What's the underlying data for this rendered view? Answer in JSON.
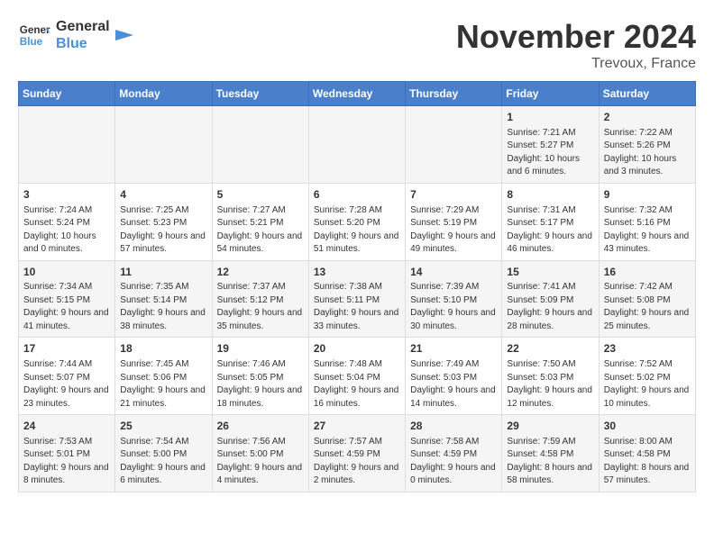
{
  "header": {
    "logo_line1": "General",
    "logo_line2": "Blue",
    "month": "November 2024",
    "location": "Trevoux, France"
  },
  "days_of_week": [
    "Sunday",
    "Monday",
    "Tuesday",
    "Wednesday",
    "Thursday",
    "Friday",
    "Saturday"
  ],
  "weeks": [
    [
      {
        "day": "",
        "info": ""
      },
      {
        "day": "",
        "info": ""
      },
      {
        "day": "",
        "info": ""
      },
      {
        "day": "",
        "info": ""
      },
      {
        "day": "",
        "info": ""
      },
      {
        "day": "1",
        "info": "Sunrise: 7:21 AM\nSunset: 5:27 PM\nDaylight: 10 hours and 6 minutes."
      },
      {
        "day": "2",
        "info": "Sunrise: 7:22 AM\nSunset: 5:26 PM\nDaylight: 10 hours and 3 minutes."
      }
    ],
    [
      {
        "day": "3",
        "info": "Sunrise: 7:24 AM\nSunset: 5:24 PM\nDaylight: 10 hours and 0 minutes."
      },
      {
        "day": "4",
        "info": "Sunrise: 7:25 AM\nSunset: 5:23 PM\nDaylight: 9 hours and 57 minutes."
      },
      {
        "day": "5",
        "info": "Sunrise: 7:27 AM\nSunset: 5:21 PM\nDaylight: 9 hours and 54 minutes."
      },
      {
        "day": "6",
        "info": "Sunrise: 7:28 AM\nSunset: 5:20 PM\nDaylight: 9 hours and 51 minutes."
      },
      {
        "day": "7",
        "info": "Sunrise: 7:29 AM\nSunset: 5:19 PM\nDaylight: 9 hours and 49 minutes."
      },
      {
        "day": "8",
        "info": "Sunrise: 7:31 AM\nSunset: 5:17 PM\nDaylight: 9 hours and 46 minutes."
      },
      {
        "day": "9",
        "info": "Sunrise: 7:32 AM\nSunset: 5:16 PM\nDaylight: 9 hours and 43 minutes."
      }
    ],
    [
      {
        "day": "10",
        "info": "Sunrise: 7:34 AM\nSunset: 5:15 PM\nDaylight: 9 hours and 41 minutes."
      },
      {
        "day": "11",
        "info": "Sunrise: 7:35 AM\nSunset: 5:14 PM\nDaylight: 9 hours and 38 minutes."
      },
      {
        "day": "12",
        "info": "Sunrise: 7:37 AM\nSunset: 5:12 PM\nDaylight: 9 hours and 35 minutes."
      },
      {
        "day": "13",
        "info": "Sunrise: 7:38 AM\nSunset: 5:11 PM\nDaylight: 9 hours and 33 minutes."
      },
      {
        "day": "14",
        "info": "Sunrise: 7:39 AM\nSunset: 5:10 PM\nDaylight: 9 hours and 30 minutes."
      },
      {
        "day": "15",
        "info": "Sunrise: 7:41 AM\nSunset: 5:09 PM\nDaylight: 9 hours and 28 minutes."
      },
      {
        "day": "16",
        "info": "Sunrise: 7:42 AM\nSunset: 5:08 PM\nDaylight: 9 hours and 25 minutes."
      }
    ],
    [
      {
        "day": "17",
        "info": "Sunrise: 7:44 AM\nSunset: 5:07 PM\nDaylight: 9 hours and 23 minutes."
      },
      {
        "day": "18",
        "info": "Sunrise: 7:45 AM\nSunset: 5:06 PM\nDaylight: 9 hours and 21 minutes."
      },
      {
        "day": "19",
        "info": "Sunrise: 7:46 AM\nSunset: 5:05 PM\nDaylight: 9 hours and 18 minutes."
      },
      {
        "day": "20",
        "info": "Sunrise: 7:48 AM\nSunset: 5:04 PM\nDaylight: 9 hours and 16 minutes."
      },
      {
        "day": "21",
        "info": "Sunrise: 7:49 AM\nSunset: 5:03 PM\nDaylight: 9 hours and 14 minutes."
      },
      {
        "day": "22",
        "info": "Sunrise: 7:50 AM\nSunset: 5:03 PM\nDaylight: 9 hours and 12 minutes."
      },
      {
        "day": "23",
        "info": "Sunrise: 7:52 AM\nSunset: 5:02 PM\nDaylight: 9 hours and 10 minutes."
      }
    ],
    [
      {
        "day": "24",
        "info": "Sunrise: 7:53 AM\nSunset: 5:01 PM\nDaylight: 9 hours and 8 minutes."
      },
      {
        "day": "25",
        "info": "Sunrise: 7:54 AM\nSunset: 5:00 PM\nDaylight: 9 hours and 6 minutes."
      },
      {
        "day": "26",
        "info": "Sunrise: 7:56 AM\nSunset: 5:00 PM\nDaylight: 9 hours and 4 minutes."
      },
      {
        "day": "27",
        "info": "Sunrise: 7:57 AM\nSunset: 4:59 PM\nDaylight: 9 hours and 2 minutes."
      },
      {
        "day": "28",
        "info": "Sunrise: 7:58 AM\nSunset: 4:59 PM\nDaylight: 9 hours and 0 minutes."
      },
      {
        "day": "29",
        "info": "Sunrise: 7:59 AM\nSunset: 4:58 PM\nDaylight: 8 hours and 58 minutes."
      },
      {
        "day": "30",
        "info": "Sunrise: 8:00 AM\nSunset: 4:58 PM\nDaylight: 8 hours and 57 minutes."
      }
    ]
  ]
}
